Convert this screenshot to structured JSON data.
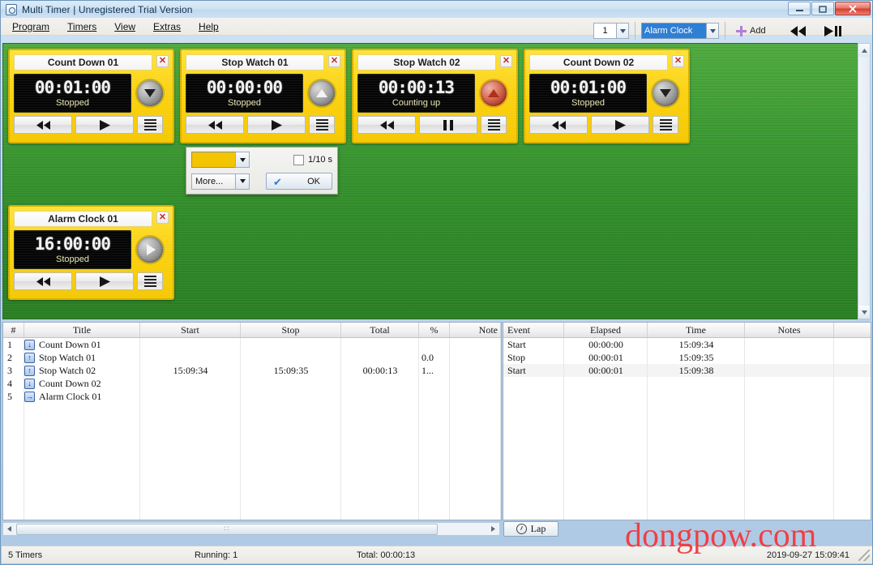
{
  "window": {
    "title": "Multi Timer | Unregistered Trial Version",
    "minimize_label": "–",
    "restore_label": "❐",
    "close_label": "✕"
  },
  "menubar": {
    "items": [
      {
        "label": "Program"
      },
      {
        "label": "Timers"
      },
      {
        "label": "View"
      },
      {
        "label": "Extras"
      },
      {
        "label": "Help"
      }
    ]
  },
  "toolbar": {
    "count_value": "1",
    "timer_type_value": "Alarm Clock",
    "add_label": "Add",
    "rewind_all_label": "◀◀",
    "playpause_all_label": "▶❘❘"
  },
  "timers": [
    {
      "title": "Count Down 01",
      "time": "00:01:00",
      "status": "Stopped",
      "knob": "triangle-down",
      "knob_color": "gray",
      "play_state": "play",
      "close_label": "✕"
    },
    {
      "title": "Stop Watch 01",
      "time": "00:00:00",
      "status": "Stopped",
      "knob": "triangle-up",
      "knob_color": "gray",
      "play_state": "play",
      "close_label": "✕"
    },
    {
      "title": "Stop Watch 02",
      "time": "00:00:13",
      "status": "Counting up",
      "knob": "triangle-up",
      "knob_color": "red",
      "play_state": "pause",
      "close_label": "✕"
    },
    {
      "title": "Count Down 02",
      "time": "00:01:00",
      "status": "Stopped",
      "knob": "triangle-down",
      "knob_color": "gray",
      "play_state": "play",
      "close_label": "✕"
    },
    {
      "title": "Alarm Clock 01",
      "time": "16:00:00",
      "status": "Stopped",
      "knob": "triangle-right",
      "knob_color": "gray",
      "play_state": "play",
      "close_label": "✕"
    }
  ],
  "popup": {
    "color_value": "#f3c400",
    "more_label": "More...",
    "tenth_label": "1/10 s",
    "tenth_checked": false,
    "ok_label": "OK"
  },
  "timer_table": {
    "columns": [
      "#",
      "Title",
      "Start",
      "Stop",
      "Total",
      "%",
      "Note"
    ],
    "rows": [
      {
        "num": "1",
        "dir": "↓",
        "title": "Count Down 01",
        "start": "",
        "stop": "",
        "total": "",
        "pct": "",
        "note": ""
      },
      {
        "num": "2",
        "dir": "↑",
        "title": "Stop Watch 01",
        "start": "",
        "stop": "",
        "total": "",
        "pct": "0.0",
        "note": ""
      },
      {
        "num": "3",
        "dir": "↑",
        "title": "Stop Watch 02",
        "start": "15:09:34",
        "stop": "15:09:35",
        "total": "00:00:13",
        "pct": "1...",
        "note": ""
      },
      {
        "num": "4",
        "dir": "↓",
        "title": "Count Down 02",
        "start": "",
        "stop": "",
        "total": "",
        "pct": "",
        "note": ""
      },
      {
        "num": "5",
        "dir": "→",
        "title": "Alarm Clock 01",
        "start": "",
        "stop": "",
        "total": "",
        "pct": "",
        "note": ""
      }
    ]
  },
  "event_table": {
    "columns": [
      "Event",
      "Elapsed",
      "Time",
      "Notes"
    ],
    "rows": [
      {
        "event": "Start",
        "elapsed": "00:00:00",
        "time": "15:09:34",
        "notes": ""
      },
      {
        "event": "Stop",
        "elapsed": "00:00:01",
        "time": "15:09:35",
        "notes": ""
      },
      {
        "event": "Start",
        "elapsed": "00:00:01",
        "time": "15:09:38",
        "notes": ""
      }
    ]
  },
  "bottom": {
    "lap_label": "Lap",
    "scroll_grip": "∷"
  },
  "statusbar": {
    "timers_count": "5 Timers",
    "running": "Running: 1",
    "total": "Total: 00:00:13",
    "datetime": "2019-09-27 15:09:41"
  },
  "watermark": {
    "text": "dongpow.com",
    "color": "#f0373c"
  }
}
